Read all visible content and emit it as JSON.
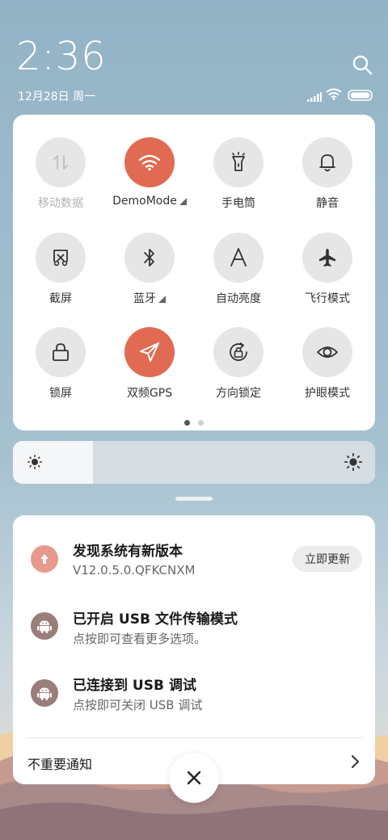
{
  "status": {
    "time": "2:36",
    "date": "12月28日 周一",
    "icons": [
      "signal-icon",
      "wifi-icon",
      "battery-icon"
    ]
  },
  "header": {
    "search_icon": "search-icon"
  },
  "quick_settings": {
    "tiles": [
      {
        "label": "移动数据",
        "icon": "mobile-data-icon",
        "state": "disabled"
      },
      {
        "label": "DemoMode",
        "icon": "wifi-icon",
        "state": "active",
        "has_more": true
      },
      {
        "label": "手电筒",
        "icon": "flashlight-icon",
        "state": "off"
      },
      {
        "label": "静音",
        "icon": "bell-icon",
        "state": "off"
      },
      {
        "label": "截屏",
        "icon": "screenshot-icon",
        "state": "off"
      },
      {
        "label": "蓝牙",
        "icon": "bluetooth-icon",
        "state": "off",
        "has_more": true
      },
      {
        "label": "自动亮度",
        "icon": "auto-brightness-icon",
        "state": "off"
      },
      {
        "label": "飞行模式",
        "icon": "airplane-icon",
        "state": "off"
      },
      {
        "label": "锁屏",
        "icon": "lock-icon",
        "state": "off"
      },
      {
        "label": "双频GPS",
        "icon": "gps-icon",
        "state": "active"
      },
      {
        "label": "方向锁定",
        "icon": "rotation-lock-icon",
        "state": "off"
      },
      {
        "label": "护眼模式",
        "icon": "eye-icon",
        "state": "off"
      }
    ],
    "page_count": 2,
    "current_page": 1
  },
  "brightness": {
    "level": 0.22
  },
  "notifications": [
    {
      "title": "发现系统有新版本",
      "subtitle": "V12.0.5.0.QFKCNXM",
      "icon": "update-arrow-icon",
      "action": "立即更新"
    },
    {
      "title": "已开启 USB 文件传输模式",
      "subtitle": "点按即可查看更多选项。",
      "icon": "android-icon"
    },
    {
      "title": "已连接到 USB 调试",
      "subtitle": "点按即可关闭 USB 调试",
      "icon": "android-icon"
    }
  ],
  "unimportant": {
    "label": "不重要通知"
  },
  "colors": {
    "accent": "#e06a52",
    "update_icon_bg": "#e8998c",
    "android_icon_bg": "#9b7d7a"
  }
}
